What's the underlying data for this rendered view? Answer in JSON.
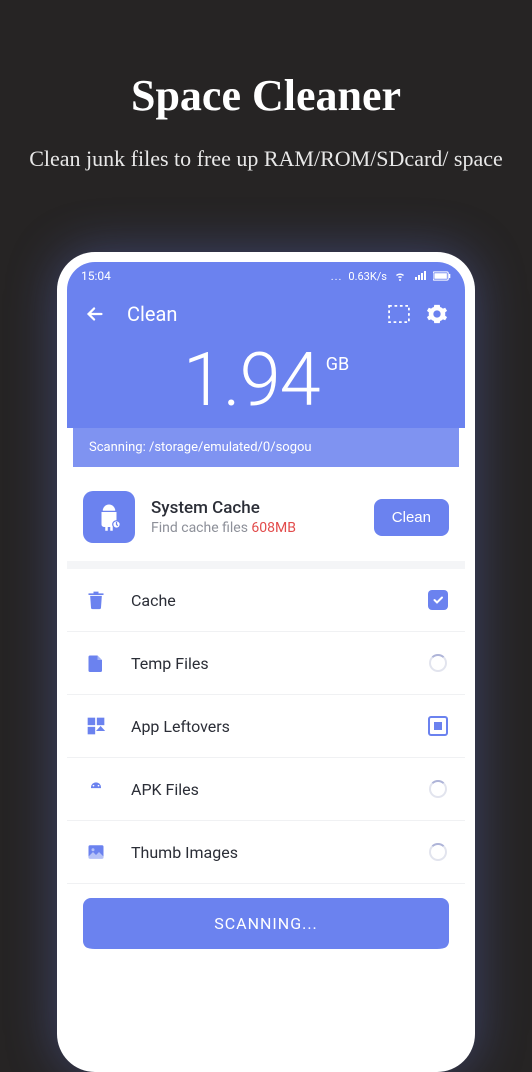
{
  "hero": {
    "title": "Space Cleaner",
    "subtitle": "Clean junk files to free up RAM/ROM/SDcard/ space"
  },
  "statusbar": {
    "time": "15:04",
    "speed": "0.63K/s"
  },
  "header": {
    "title": "Clean"
  },
  "sizePanel": {
    "value": "1.94",
    "unit": "GB"
  },
  "scanBar": {
    "text": "Scanning: /storage/emulated/0/sogou"
  },
  "systemCard": {
    "title": "System Cache",
    "subPrefix": "Find cache files ",
    "subValue": "608MB",
    "button": "Clean"
  },
  "list": {
    "cache": "Cache",
    "temp": "Temp Files",
    "leftovers": "App Leftovers",
    "apk": "APK Files",
    "thumb": "Thumb Images"
  },
  "scanButton": "SCANNING..."
}
